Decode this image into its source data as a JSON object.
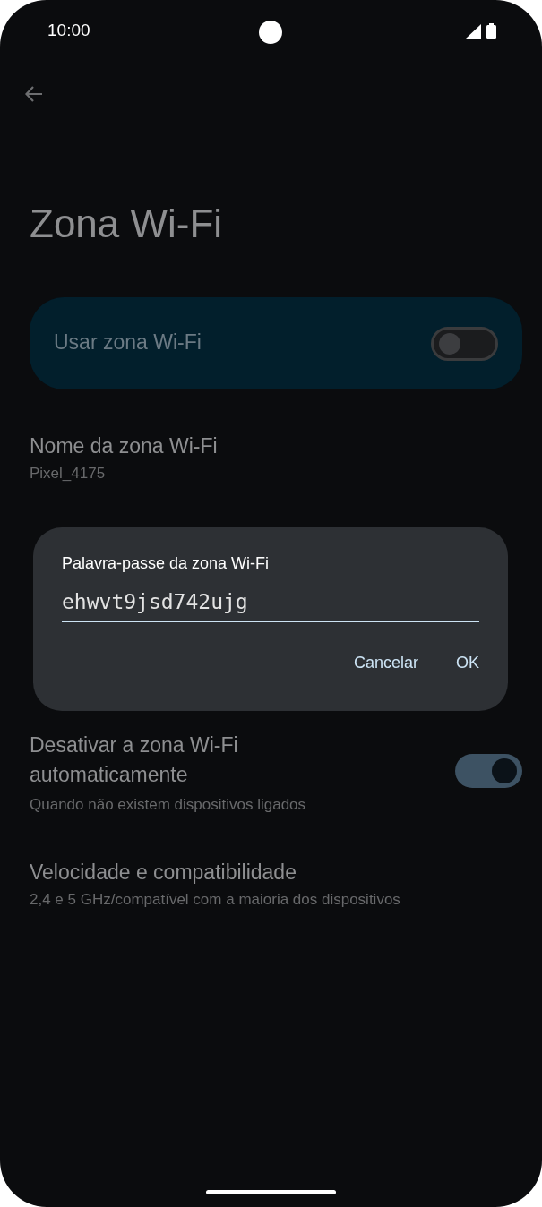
{
  "status_bar": {
    "time": "10:00"
  },
  "title": "Zona Wi-Fi",
  "main_switch": {
    "label": "Usar zona Wi-Fi",
    "on": false
  },
  "settings": [
    {
      "kind": "text",
      "title": "Nome da zona Wi-Fi",
      "subtitle": "Pixel_4175"
    },
    {
      "kind": "switch",
      "title": "Desativar a zona Wi-Fi automaticamente",
      "subtitle": "Quando não existem dispositivos ligados",
      "on": true
    },
    {
      "kind": "text",
      "title": "Velocidade e compatibilidade",
      "subtitle": "2,4 e 5 GHz/compatível com a maioria dos dispositivos"
    }
  ],
  "dialog": {
    "title": "Palavra-passe da zona Wi-Fi",
    "value": "ehwvt9jsd742ujg",
    "buttons": [
      "Cancelar",
      "OK"
    ]
  }
}
